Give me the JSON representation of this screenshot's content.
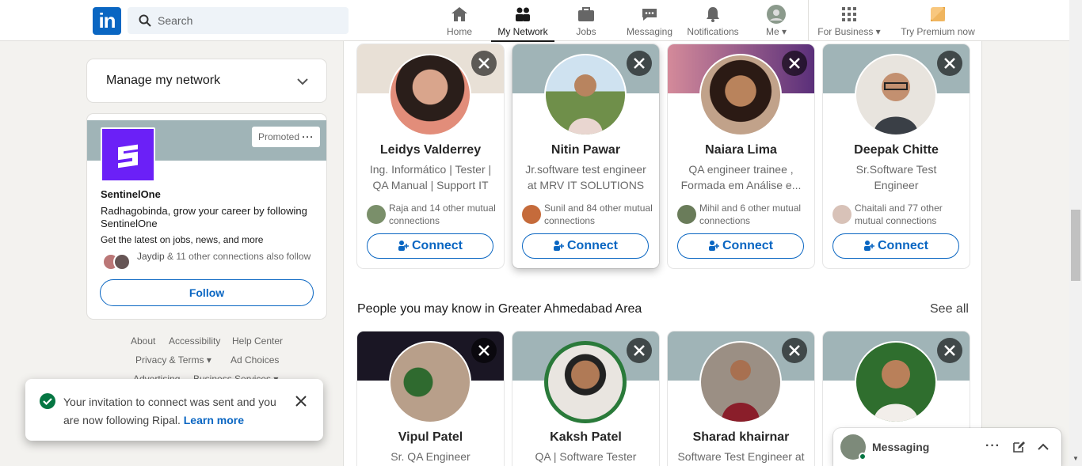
{
  "nav": {
    "logo": "in",
    "search_placeholder": "Search",
    "items": [
      {
        "label": "Home",
        "icon": "home-icon"
      },
      {
        "label": "My Network",
        "icon": "network-icon"
      },
      {
        "label": "Jobs",
        "icon": "briefcase-icon"
      },
      {
        "label": "Messaging",
        "icon": "chat-icon"
      },
      {
        "label": "Notifications",
        "icon": "bell-icon"
      },
      {
        "label": "Me",
        "icon": "avatar"
      },
      {
        "label": "For Business",
        "icon": "grid-icon"
      },
      {
        "label": "Try Premium now",
        "icon": "premium-icon"
      }
    ]
  },
  "sidebar": {
    "manage": "Manage my network",
    "promo": {
      "tag": "Promoted",
      "company": "SentinelOne",
      "pitch": "Radhagobinda, grow your career by following SentinelOne",
      "sub": "Get the latest on jobs, news, and more",
      "conn_name": "Jaydip",
      "conn_rest": "& 11 other connections also follow",
      "follow": "Follow"
    },
    "footer": {
      "about": "About",
      "access": "Accessibility",
      "help": "Help Center",
      "privacy": "Privacy & Terms",
      "adchoices": "Ad Choices",
      "advertising": "Advertising",
      "business": "Business Services"
    }
  },
  "toast": {
    "message": "Your invitation to connect was sent and you are now following Ripal.",
    "link": "Learn more"
  },
  "people_top": [
    {
      "name": "Leidys Valderrey",
      "headline": "Ing. Informático | Tester | QA Manual | Support IT ...",
      "mutual": "Raja and 14 other mutual connections",
      "connect": "Connect"
    },
    {
      "name": "Nitin Pawar",
      "headline": "Jr.software test engineer at MRV IT SOLUTIONS",
      "mutual": "Sunil and 84 other mutual connections",
      "connect": "Connect"
    },
    {
      "name": "Naiara Lima",
      "headline": "QA engineer trainee , Formada em Análise e...",
      "mutual": "Mihil and 6 other mutual connections",
      "connect": "Connect"
    },
    {
      "name": "Deepak Chitte",
      "headline": "Sr.Software Test Engineer",
      "mutual": "Chaitali and 77 other mutual connections",
      "connect": "Connect"
    }
  ],
  "section2": {
    "title": "People you may know in Greater Ahmedabad Area",
    "see_all": "See all"
  },
  "people_bottom": [
    {
      "name": "Vipul Patel",
      "headline": "Sr. QA Engineer"
    },
    {
      "name": "Kaksh Patel",
      "headline": "QA | Software Tester"
    },
    {
      "name": "Sharad khairnar",
      "headline": "Software Test Engineer at"
    },
    {
      "name": "",
      "headline": ""
    }
  ],
  "messaging": {
    "label": "Messaging"
  },
  "colors": {
    "brand": "#0a66c2",
    "success": "#057642"
  }
}
